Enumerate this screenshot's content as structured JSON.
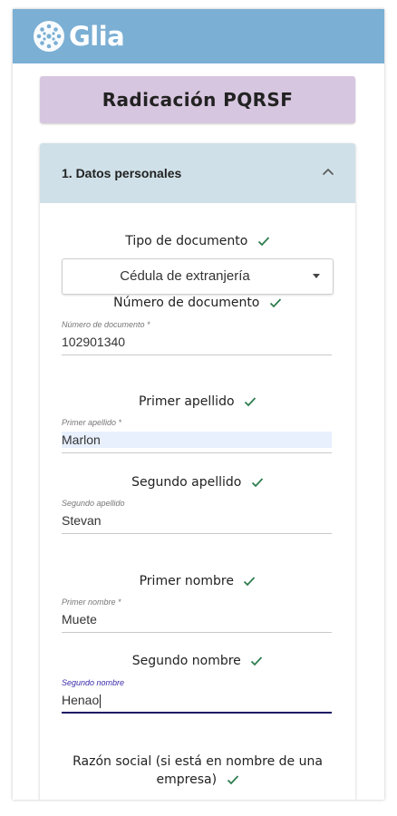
{
  "brand": {
    "name": "Glia"
  },
  "header": {
    "title": "Radicación PQRSF"
  },
  "section": {
    "title": "1. Datos personales"
  },
  "form": {
    "tipo_documento": {
      "label": "Tipo de documento",
      "value": "Cédula de extranjería"
    },
    "numero_documento": {
      "label": "Número de documento",
      "float_label": "Número de documento *",
      "value": "102901340"
    },
    "primer_apellido": {
      "label": "Primer apellido",
      "float_label": "Primer apellido *",
      "value": "Marlon"
    },
    "segundo_apellido": {
      "label": "Segundo apellido",
      "float_label": "Segundo apellido",
      "value": "Stevan"
    },
    "primer_nombre": {
      "label": "Primer nombre",
      "float_label": "Primer nombre *",
      "value": "Muete"
    },
    "segundo_nombre": {
      "label": "Segundo nombre",
      "float_label": "Segundo nombre",
      "value": "Henao"
    },
    "razon_social": {
      "label": "Razón social (si está en nombre de una empresa)"
    }
  },
  "colors": {
    "topbar": "#7bafd4",
    "title_bg": "#d7c6df",
    "section_bg": "#cfe0e8",
    "check": "#2e7d4f",
    "focus": "#1e1663"
  },
  "icons": {
    "logo": "glia-logo-icon",
    "collapse": "chevron-up-icon",
    "dropdown": "caret-down-icon",
    "valid": "check-icon"
  }
}
